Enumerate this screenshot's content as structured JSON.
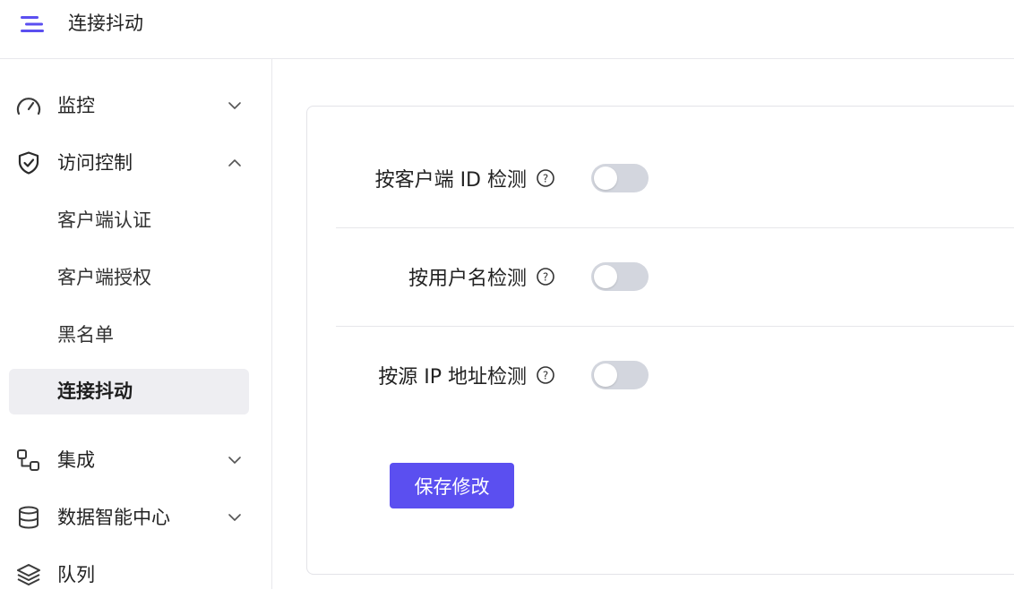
{
  "header": {
    "title": "连接抖动",
    "menu_icon": "hamburger-menu-icon",
    "accent": "#5b4ff0"
  },
  "sidebar": {
    "items": [
      {
        "label": "监控",
        "icon": "gauge-icon",
        "expanded": false
      },
      {
        "label": "访问控制",
        "icon": "shield-check-icon",
        "expanded": true,
        "children": [
          "客户端认证",
          "客户端授权",
          "黑名单",
          "连接抖动"
        ],
        "active_child": "连接抖动"
      },
      {
        "label": "集成",
        "icon": "integration-nodes-icon",
        "expanded": false
      },
      {
        "label": "数据智能中心",
        "icon": "database-icon",
        "expanded": false
      },
      {
        "label": "队列",
        "icon": "layers-icon",
        "expanded": false
      }
    ]
  },
  "settings": {
    "rows": [
      {
        "label": "按客户端 ID 检测",
        "enabled": false
      },
      {
        "label": "按用户名检测",
        "enabled": false
      },
      {
        "label": "按源 IP 地址检测",
        "enabled": false
      }
    ],
    "save_label": "保存修改"
  },
  "colors": {
    "primary": "#5b4ff0",
    "toggle_off": "#d3d6de",
    "active_bg": "#eeeef2"
  }
}
